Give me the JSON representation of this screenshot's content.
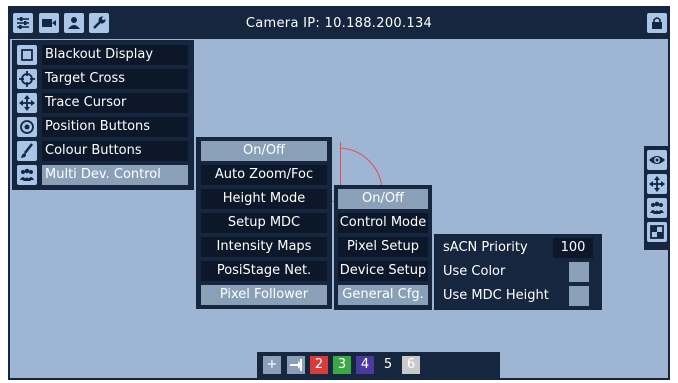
{
  "header": {
    "title": "Camera IP: 10.188.200.134",
    "icons": [
      "sliders-icon",
      "camera-icon",
      "user-icon",
      "wrench-icon"
    ],
    "lock_icon": "lock-icon"
  },
  "left_menu": {
    "items": [
      {
        "label": "Blackout Display",
        "icon": "square-icon"
      },
      {
        "label": "Target Cross",
        "icon": "crosshair-icon"
      },
      {
        "label": "Trace Cursor",
        "icon": "move-icon"
      },
      {
        "label": "Position Buttons",
        "icon": "target-circle-icon"
      },
      {
        "label": "Colour Buttons",
        "icon": "brush-icon"
      },
      {
        "label": "Multi Dev. Control",
        "icon": "users-icon"
      }
    ],
    "active_index": 5
  },
  "mdc_menu": {
    "items": [
      "On/Off",
      "Auto Zoom/Foc",
      "Height Mode",
      "Setup MDC",
      "Intensity Maps",
      "PosiStage Net.",
      "Pixel Follower"
    ],
    "active": [
      "On/Off",
      "Pixel Follower"
    ]
  },
  "pixel_menu": {
    "items": [
      "On/Off",
      "Control Mode",
      "Pixel Setup",
      "Device Setup",
      "General Cfg."
    ],
    "active": [
      "On/Off",
      "General Cfg."
    ]
  },
  "general_cfg": {
    "sacn_label": "sACN Priority",
    "sacn_value": "100",
    "use_color_label": "Use Color",
    "use_mdc_height_label": "Use MDC Height"
  },
  "right_tools": [
    "eye-icon",
    "move-icon",
    "users-icon",
    "layers-icon"
  ],
  "bottom_bar": {
    "plus": "+",
    "login_icon": "login-icon",
    "numbers": [
      {
        "label": "2",
        "color": "#d93a3a"
      },
      {
        "label": "3",
        "color": "#3aa845"
      },
      {
        "label": "4",
        "color": "#4a3a9e"
      },
      {
        "label": "5",
        "color": ""
      },
      {
        "label": "6",
        "color": "#c9c9c9"
      }
    ]
  },
  "colors": {
    "accent": "#16263f",
    "background": "#9fb5d4",
    "crosshair": "#e05050"
  }
}
